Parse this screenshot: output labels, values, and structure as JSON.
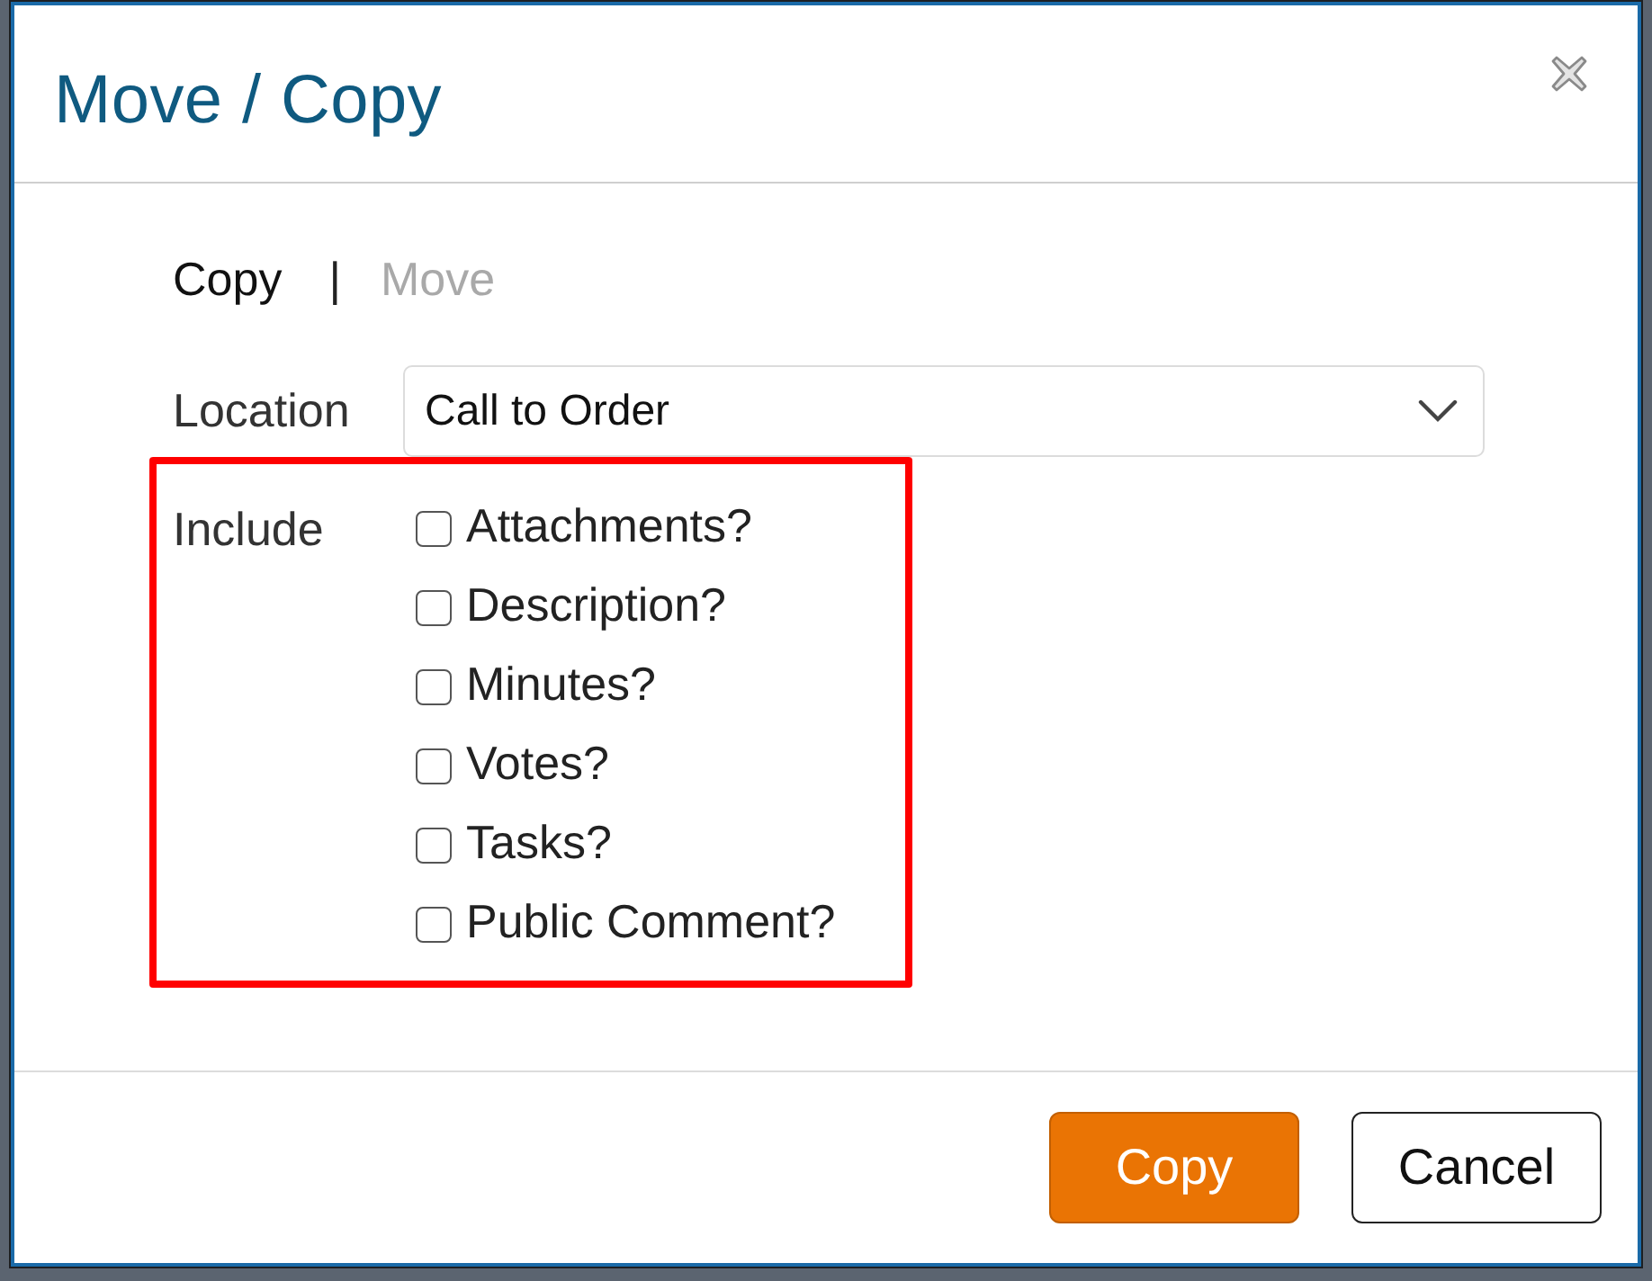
{
  "dialog": {
    "title": "Move / Copy"
  },
  "mode_tabs": [
    {
      "label": "Copy",
      "selected": true
    },
    {
      "label": "Move",
      "selected": false
    }
  ],
  "mode_separator": "|",
  "location": {
    "label": "Location",
    "value": "Call to Order"
  },
  "include": {
    "label": "Include",
    "options": [
      {
        "label": "Attachments?",
        "checked": false
      },
      {
        "label": "Description?",
        "checked": false
      },
      {
        "label": "Minutes?",
        "checked": false
      },
      {
        "label": "Votes?",
        "checked": false
      },
      {
        "label": "Tasks?",
        "checked": false
      },
      {
        "label": "Public Comment?",
        "checked": false
      }
    ]
  },
  "buttons": [
    {
      "label": "Copy",
      "kind": "primary"
    },
    {
      "label": "Cancel",
      "kind": "secondary"
    }
  ]
}
